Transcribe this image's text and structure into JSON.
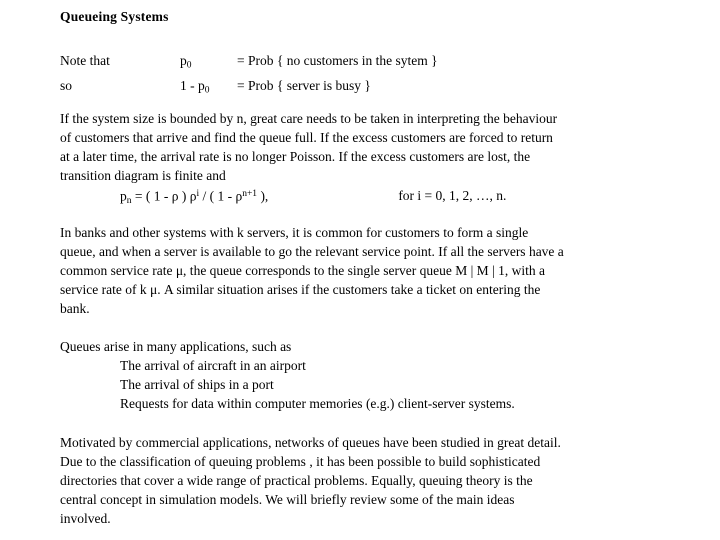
{
  "document": {
    "title": "Queueing Systems",
    "background_color": "#ffffff",
    "text_color": "#000000"
  },
  "definitions": {
    "rows": [
      {
        "lead": "Note that",
        "symbol_html": "p0",
        "symbol_base": "p",
        "symbol_sub": "0",
        "description": "= Prob { no customers in the sytem }"
      },
      {
        "lead": "so",
        "symbol_html": "1 - p0",
        "symbol_base": "1 - p",
        "symbol_sub": "0",
        "description": "= Prob { server is busy }"
      }
    ]
  },
  "paragraph_bounded": {
    "lines": [
      "If the system size is bounded by n, great care needs to be taken in interpreting the behaviour",
      "of customers that arrive and find the queue full. If the excess customers are forced to return",
      "at a later time, the arrival rate is no longer Poisson. If the excess customers are lost, the",
      "transition diagram is finite and"
    ]
  },
  "formula": {
    "lhs_prefix": "p",
    "lhs_sub": "n",
    "lhs_mid": " = ( 1 - ρ ) ρ",
    "lhs_sup1": "i",
    "lhs_mid2": " / ( 1 - ρ",
    "lhs_sup2": "n+1",
    "lhs_suffix": " ),",
    "lhs_plain": "pn = ( 1 - ρ ) ρ i / ( 1 - ρ n+1 ),",
    "rhs": "for i = 0, 1, 2, …, n."
  },
  "paragraph_banks": {
    "lines": [
      "In banks and other systems with k servers, it is common for customers to form a single",
      "queue, and when a server is available to go the relevant service point. If all the servers have a",
      "common service rate μ, the queue corresponds to the single server queue M | M | 1, with a",
      "service rate of  k μ. A similar situation arises if the customers take a ticket on entering the",
      "bank."
    ]
  },
  "paragraph_applications": {
    "intro": "Queues arise in many applications, such as",
    "items": [
      "The arrival of aircraft in an airport",
      "The arrival of ships in a port",
      "Requests for data within computer memories (e.g.) client-server systems."
    ]
  },
  "paragraph_motivation": {
    "lines": [
      "Motivated by commercial applications, networks of queues have been studied in great detail.",
      "Due to the classification of queuing problems , it has been possible to build sophisticated",
      "directories that cover a wide range of practical problems.  Equally, queuing theory is the",
      "central concept in simulation models. We will briefly review some of the main ideas",
      "involved."
    ]
  }
}
